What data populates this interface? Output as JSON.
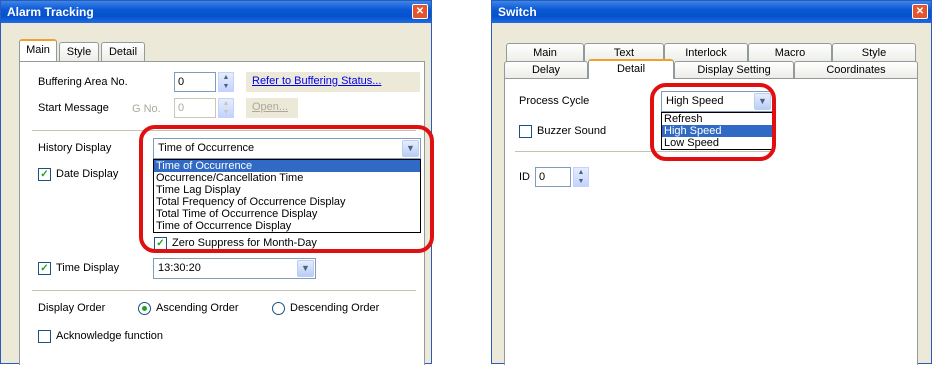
{
  "alarm": {
    "title": "Alarm Tracking",
    "tabs": [
      "Main",
      "Style",
      "Detail"
    ],
    "buffering_label": "Buffering Area No.",
    "buffering_value": "0",
    "buffering_link": "Refer to Buffering Status...",
    "start_message_label": "Start Message",
    "gno_label": "G No.",
    "gno_value": "0",
    "open_label": "Open...",
    "history_label": "History Display",
    "history_value": "Time of Occurrence",
    "history_options": [
      "Time of Occurrence",
      "Occurrence/Cancellation Time",
      "Time Lag Display",
      "Total Frequency of Occurrence Display",
      "Total Time of Occurrence Display",
      "Time of Occurrence Display"
    ],
    "date_display_label": "Date Display",
    "zero_suppress_label": "Zero Suppress for Month-Day",
    "time_display_label": "Time Display",
    "time_value": "13:30:20",
    "display_order_label": "Display Order",
    "ascending_label": "Ascending Order",
    "descending_label": "Descending Order",
    "acknowledge_label": "Acknowledge function"
  },
  "switch": {
    "title": "Switch",
    "tabs_row1": [
      "Main",
      "Text",
      "Interlock",
      "Macro",
      "Style"
    ],
    "tabs_row2": [
      "Delay",
      "Detail",
      "Display Setting",
      "Coordinates"
    ],
    "process_cycle_label": "Process Cycle",
    "process_cycle_value": "High Speed",
    "process_cycle_options": [
      "Refresh",
      "High Speed",
      "Low Speed"
    ],
    "buzzer_label": "Buzzer Sound",
    "id_label": "ID",
    "id_value": "0"
  },
  "icons": {
    "close": "close-icon",
    "checkmark": "checkmark-icon",
    "spin": "spin-icon",
    "dropdown": "chevron-down-icon"
  },
  "colors": {
    "title_bar": "#0a57d5",
    "highlight": "#e01010",
    "selection": "#316ac5"
  }
}
